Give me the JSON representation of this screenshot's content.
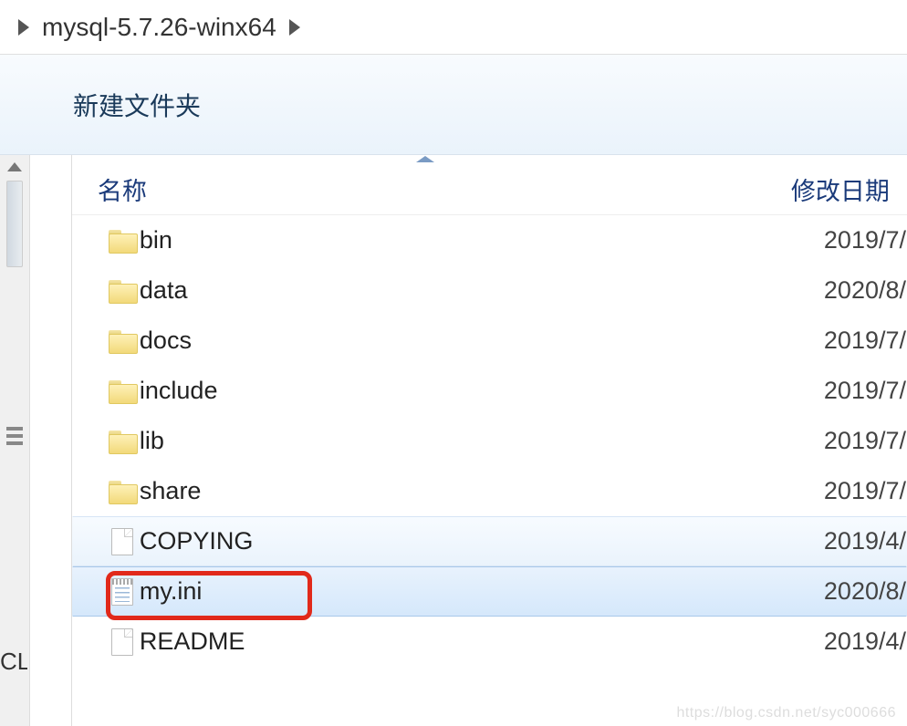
{
  "breadcrumb": {
    "folder": "mysql-5.7.26-winx64"
  },
  "toolbar": {
    "new_folder_label": "新建文件夹"
  },
  "columns": {
    "name": "名称",
    "date": "修改日期"
  },
  "sidebar": {
    "truncated_label": "CL"
  },
  "files": [
    {
      "name": "bin",
      "type": "folder",
      "date": "2019/7/",
      "state": ""
    },
    {
      "name": "data",
      "type": "folder",
      "date": "2020/8/",
      "state": ""
    },
    {
      "name": "docs",
      "type": "folder",
      "date": "2019/7/",
      "state": ""
    },
    {
      "name": "include",
      "type": "folder",
      "date": "2019/7/",
      "state": ""
    },
    {
      "name": "lib",
      "type": "folder",
      "date": "2019/7/",
      "state": ""
    },
    {
      "name": "share",
      "type": "folder",
      "date": "2019/7/",
      "state": ""
    },
    {
      "name": "COPYING",
      "type": "file",
      "date": "2019/4/",
      "state": "hovered"
    },
    {
      "name": "my.ini",
      "type": "ini",
      "date": "2020/8/",
      "state": "selected"
    },
    {
      "name": "README",
      "type": "file",
      "date": "2019/4/",
      "state": ""
    }
  ],
  "highlight": {
    "target_index": 7
  },
  "watermark": "https://blog.csdn.net/syc000666"
}
